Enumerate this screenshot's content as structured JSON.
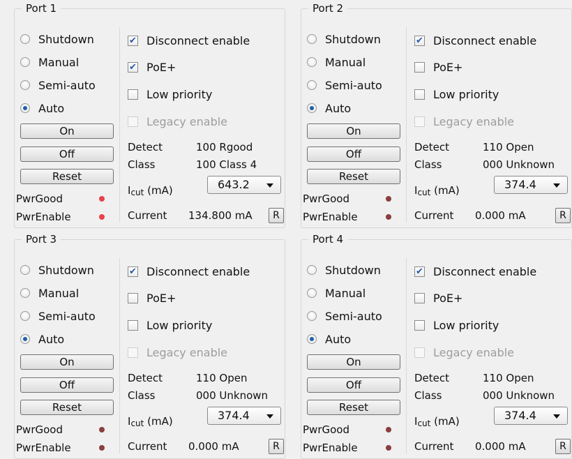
{
  "colors": {
    "led_active": "#e8424a",
    "led_inactive": "#8a3e3e",
    "radio_selected": "#1d5fa8",
    "check_mark": "#2b57a8"
  },
  "ports": [
    {
      "title": "Port 1",
      "modes": {
        "selected": "Auto",
        "options": [
          "Shutdown",
          "Manual",
          "Semi-auto",
          "Auto"
        ]
      },
      "buttons": {
        "on": "On",
        "off": "Off",
        "reset": "Reset"
      },
      "status": {
        "pwr_good": "PwrGood",
        "pwr_enable": "PwrEnable",
        "pwr_good_active": true,
        "pwr_enable_active": true
      },
      "checks": {
        "disconnect_enable": {
          "label": "Disconnect enable",
          "checked": true
        },
        "poe_plus": {
          "label": "PoE+",
          "checked": true
        },
        "low_priority": {
          "label": "Low priority",
          "checked": false
        },
        "legacy_enable": {
          "label": "Legacy enable",
          "checked": false,
          "disabled": true
        }
      },
      "detect_label": "Detect",
      "detect_value": "100 Rgood",
      "class_label": "Class",
      "class_value": "100 Class 4",
      "icut_label_main": "I",
      "icut_label_sub": "cut",
      "icut_label_unit": "(mA)",
      "icut_value": "643.2",
      "current_label": "Current",
      "current_value": "134.800 mA",
      "refresh_label": "R"
    },
    {
      "title": "Port 2",
      "modes": {
        "selected": "Auto",
        "options": [
          "Shutdown",
          "Manual",
          "Semi-auto",
          "Auto"
        ]
      },
      "buttons": {
        "on": "On",
        "off": "Off",
        "reset": "Reset"
      },
      "status": {
        "pwr_good": "PwrGood",
        "pwr_enable": "PwrEnable",
        "pwr_good_active": false,
        "pwr_enable_active": false
      },
      "checks": {
        "disconnect_enable": {
          "label": "Disconnect enable",
          "checked": true
        },
        "poe_plus": {
          "label": "PoE+",
          "checked": false
        },
        "low_priority": {
          "label": "Low priority",
          "checked": false
        },
        "legacy_enable": {
          "label": "Legacy enable",
          "checked": false,
          "disabled": true
        }
      },
      "detect_label": "Detect",
      "detect_value": "110 Open",
      "class_label": "Class",
      "class_value": "000 Unknown",
      "icut_label_main": "I",
      "icut_label_sub": "cut",
      "icut_label_unit": "(mA)",
      "icut_value": "374.4",
      "current_label": "Current",
      "current_value": "0.000 mA",
      "refresh_label": "R"
    },
    {
      "title": "Port 3",
      "modes": {
        "selected": "Auto",
        "options": [
          "Shutdown",
          "Manual",
          "Semi-auto",
          "Auto"
        ]
      },
      "buttons": {
        "on": "On",
        "off": "Off",
        "reset": "Reset"
      },
      "status": {
        "pwr_good": "PwrGood",
        "pwr_enable": "PwrEnable",
        "pwr_good_active": false,
        "pwr_enable_active": false
      },
      "checks": {
        "disconnect_enable": {
          "label": "Disconnect enable",
          "checked": true
        },
        "poe_plus": {
          "label": "PoE+",
          "checked": false
        },
        "low_priority": {
          "label": "Low priority",
          "checked": false
        },
        "legacy_enable": {
          "label": "Legacy enable",
          "checked": false,
          "disabled": true
        }
      },
      "detect_label": "Detect",
      "detect_value": "110 Open",
      "class_label": "Class",
      "class_value": "000 Unknown",
      "icut_label_main": "I",
      "icut_label_sub": "cut",
      "icut_label_unit": "(mA)",
      "icut_value": "374.4",
      "current_label": "Current",
      "current_value": "0.000 mA",
      "refresh_label": "R"
    },
    {
      "title": "Port 4",
      "modes": {
        "selected": "Auto",
        "options": [
          "Shutdown",
          "Manual",
          "Semi-auto",
          "Auto"
        ]
      },
      "buttons": {
        "on": "On",
        "off": "Off",
        "reset": "Reset"
      },
      "status": {
        "pwr_good": "PwrGood",
        "pwr_enable": "PwrEnable",
        "pwr_good_active": false,
        "pwr_enable_active": false
      },
      "checks": {
        "disconnect_enable": {
          "label": "Disconnect enable",
          "checked": true
        },
        "poe_plus": {
          "label": "PoE+",
          "checked": false
        },
        "low_priority": {
          "label": "Low priority",
          "checked": false
        },
        "legacy_enable": {
          "label": "Legacy enable",
          "checked": false,
          "disabled": true
        }
      },
      "detect_label": "Detect",
      "detect_value": "110 Open",
      "class_label": "Class",
      "class_value": "000 Unknown",
      "icut_label_main": "I",
      "icut_label_sub": "cut",
      "icut_label_unit": "(mA)",
      "icut_value": "374.4",
      "current_label": "Current",
      "current_value": "0.000 mA",
      "refresh_label": "R"
    }
  ]
}
